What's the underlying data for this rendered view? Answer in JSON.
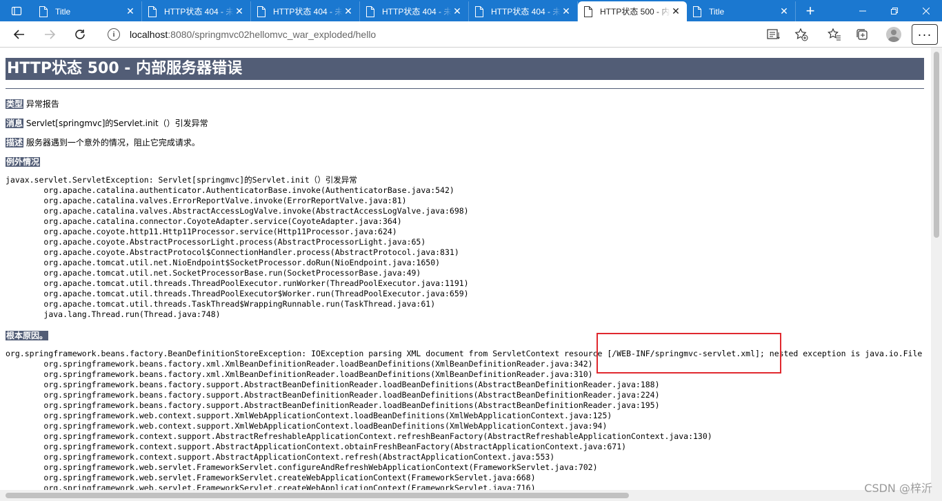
{
  "browser": {
    "tabs": [
      {
        "title": "Title",
        "active": false
      },
      {
        "title": "HTTP状态 404 - 未",
        "active": false
      },
      {
        "title": "HTTP状态 404 - 未",
        "active": false
      },
      {
        "title": "HTTP状态 404 - 未",
        "active": false
      },
      {
        "title": "HTTP状态 404 - 未",
        "active": false
      },
      {
        "title": "HTTP状态 500 - 内",
        "active": true
      },
      {
        "title": "Title",
        "active": false
      }
    ],
    "url_host": "localhost",
    "url_path": ":8080/springmvc02hellomvc_war_exploded/hello",
    "accent_color": "#1b78d0"
  },
  "error_page": {
    "heading": "HTTP状态 500 - 内部服务器错误",
    "type_label": "类型",
    "type_value": " 异常报告",
    "message_label": "消息",
    "message_value": " Servlet[springmvc]的Servlet.init（）引发异常",
    "description_label": "描述",
    "description_value": " 服务器遇到一个意外的情况，阻止它完成请求。",
    "exception_label": "例外情况",
    "exception_trace": "javax.servlet.ServletException: Servlet[springmvc]的Servlet.init（）引发异常\n\torg.apache.catalina.authenticator.AuthenticatorBase.invoke(AuthenticatorBase.java:542)\n\torg.apache.catalina.valves.ErrorReportValve.invoke(ErrorReportValve.java:81)\n\torg.apache.catalina.valves.AbstractAccessLogValve.invoke(AbstractAccessLogValve.java:698)\n\torg.apache.catalina.connector.CoyoteAdapter.service(CoyoteAdapter.java:364)\n\torg.apache.coyote.http11.Http11Processor.service(Http11Processor.java:624)\n\torg.apache.coyote.AbstractProcessorLight.process(AbstractProcessorLight.java:65)\n\torg.apache.coyote.AbstractProtocol$ConnectionHandler.process(AbstractProtocol.java:831)\n\torg.apache.tomcat.util.net.NioEndpoint$SocketProcessor.doRun(NioEndpoint.java:1650)\n\torg.apache.tomcat.util.net.SocketProcessorBase.run(SocketProcessorBase.java:49)\n\torg.apache.tomcat.util.threads.ThreadPoolExecutor.runWorker(ThreadPoolExecutor.java:1191)\n\torg.apache.tomcat.util.threads.ThreadPoolExecutor$Worker.run(ThreadPoolExecutor.java:659)\n\torg.apache.tomcat.util.threads.TaskThread$WrappingRunnable.run(TaskThread.java:61)\n\tjava.lang.Thread.run(Thread.java:748)",
    "root_cause_label": "根本原因。",
    "root_cause_trace": "org.springframework.beans.factory.BeanDefinitionStoreException: IOException parsing XML document from ServletContext resource [/WEB-INF/springmvc-servlet.xml]; nested exception is java.io.File\n\torg.springframework.beans.factory.xml.XmlBeanDefinitionReader.loadBeanDefinitions(XmlBeanDefinitionReader.java:342)\n\torg.springframework.beans.factory.xml.XmlBeanDefinitionReader.loadBeanDefinitions(XmlBeanDefinitionReader.java:310)\n\torg.springframework.beans.factory.support.AbstractBeanDefinitionReader.loadBeanDefinitions(AbstractBeanDefinitionReader.java:188)\n\torg.springframework.beans.factory.support.AbstractBeanDefinitionReader.loadBeanDefinitions(AbstractBeanDefinitionReader.java:224)\n\torg.springframework.beans.factory.support.AbstractBeanDefinitionReader.loadBeanDefinitions(AbstractBeanDefinitionReader.java:195)\n\torg.springframework.web.context.support.XmlWebApplicationContext.loadBeanDefinitions(XmlWebApplicationContext.java:125)\n\torg.springframework.web.context.support.XmlWebApplicationContext.loadBeanDefinitions(XmlWebApplicationContext.java:94)\n\torg.springframework.context.support.AbstractRefreshableApplicationContext.refreshBeanFactory(AbstractRefreshableApplicationContext.java:130)\n\torg.springframework.context.support.AbstractApplicationContext.obtainFreshBeanFactory(AbstractApplicationContext.java:671)\n\torg.springframework.context.support.AbstractApplicationContext.refresh(AbstractApplicationContext.java:553)\n\torg.springframework.web.servlet.FrameworkServlet.configureAndRefreshWebApplicationContext(FrameworkServlet.java:702)\n\torg.springframework.web.servlet.FrameworkServlet.createWebApplicationContext(FrameworkServlet.java:668)\n\torg.springframework.web.servlet.FrameworkServlet.createWebApplicationContext(FrameworkServlet.java:716)",
    "header_color": "#525d76",
    "highlight_color": "#e0282e"
  },
  "watermark": "CSDN @梓沂"
}
